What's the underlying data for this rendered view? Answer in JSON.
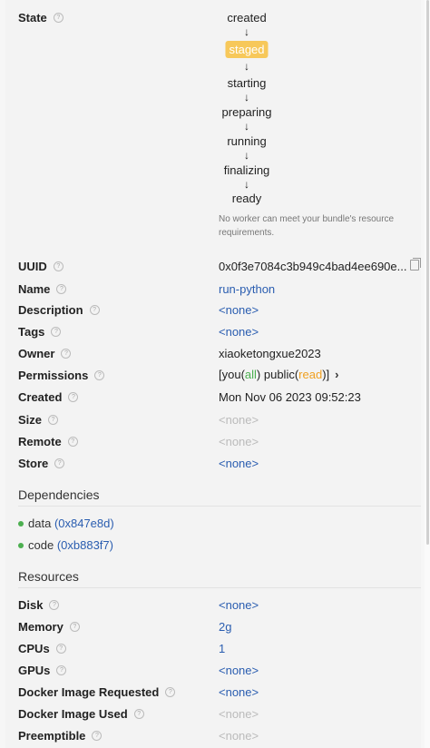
{
  "state": {
    "label": "State",
    "steps": [
      "created",
      "staged",
      "starting",
      "preparing",
      "running",
      "finalizing",
      "ready"
    ],
    "active_step": "staged",
    "arrow": "↓",
    "note_line1": "No worker can meet your bundle's resource",
    "note_line2": "requirements."
  },
  "fields": {
    "uuid": {
      "label": "UUID",
      "value": "0x0f3e7084c3b949c4bad4ee690e..."
    },
    "name": {
      "label": "Name",
      "value": "run-python"
    },
    "description": {
      "label": "Description",
      "value": "<none>"
    },
    "tags": {
      "label": "Tags",
      "value": "<none>"
    },
    "owner": {
      "label": "Owner",
      "value": "xiaoketongxue2023"
    },
    "permissions": {
      "label": "Permissions",
      "open": "[you(",
      "you_level": "all",
      "mid": ") public(",
      "public_level": "read",
      "close": ")]",
      "chevron": "›"
    },
    "created": {
      "label": "Created",
      "value": "Mon Nov 06 2023 09:52:23"
    },
    "size": {
      "label": "Size",
      "value": "<none>"
    },
    "remote": {
      "label": "Remote",
      "value": "<none>"
    },
    "store": {
      "label": "Store",
      "value": "<none>"
    }
  },
  "dependencies": {
    "title": "Dependencies",
    "items": [
      {
        "name": "data",
        "ref": "(0x847e8d)"
      },
      {
        "name": "code",
        "ref": "(0xb883f7)"
      }
    ]
  },
  "resources": {
    "title": "Resources",
    "disk": {
      "label": "Disk",
      "value": "<none>"
    },
    "memory": {
      "label": "Memory",
      "value": "2g"
    },
    "cpus": {
      "label": "CPUs",
      "value": "1"
    },
    "gpus": {
      "label": "GPUs",
      "value": "<none>"
    },
    "docker_requested": {
      "label": "Docker Image Requested",
      "value": "<none>"
    },
    "docker_used": {
      "label": "Docker Image Used",
      "value": "<none>"
    },
    "preemptible": {
      "label": "Preemptible",
      "value": "<none>"
    }
  },
  "help_glyph": "?"
}
